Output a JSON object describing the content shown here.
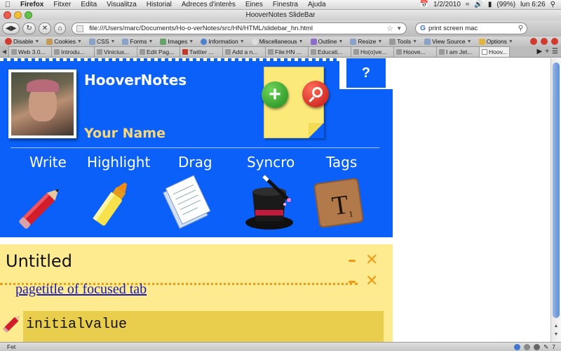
{
  "menubar": {
    "app": "Firefox",
    "items": [
      "Fitxer",
      "Edita",
      "Visualitza",
      "Historial",
      "Adreces d'interès",
      "Eines",
      "Finestra",
      "Ajuda"
    ],
    "date": "1/2/2010",
    "battery": "(99%)",
    "clock": "lun 6:26"
  },
  "window": {
    "title": "HooverNotes SlideBar"
  },
  "navbar": {
    "url": "file:///Users/marc/Documents/Ho-o-verNotes/src/HN/HTML/slidebar_hn.html",
    "search_value": "print screen mac"
  },
  "devbar": {
    "items": [
      "Disable",
      "Cookies",
      "CSS",
      "Forms",
      "Images",
      "Information",
      "Miscellaneous",
      "Outline",
      "Resize",
      "Tools",
      "View Source",
      "Options"
    ]
  },
  "tabs": [
    {
      "label": "Web 3.0..."
    },
    {
      "label": "Introdu..."
    },
    {
      "label": "Vinicius..."
    },
    {
      "label": "Edit Pag..."
    },
    {
      "label": "Twitter ..."
    },
    {
      "label": "Add a n..."
    },
    {
      "label": "File:HN ..."
    },
    {
      "label": "Educati..."
    },
    {
      "label": "Ho(o)ve..."
    },
    {
      "label": "Hoove..."
    },
    {
      "label": "I am Jet..."
    },
    {
      "label": "Hoov..."
    }
  ],
  "slidebar": {
    "title": "HooverNotes",
    "user_name": "Your Name",
    "help_label": "?",
    "add_label": "+",
    "tools": [
      {
        "label": "Write"
      },
      {
        "label": "Highlight"
      },
      {
        "label": "Drag"
      },
      {
        "label": "Syncro"
      },
      {
        "label": "Tags"
      }
    ],
    "tag_tile_letter": "T",
    "tag_tile_sub": "1"
  },
  "note": {
    "title": "Untitled",
    "minimize": "–",
    "close": "✕",
    "link_text": "pagetitle of focused tab",
    "input_value": "initialvalue"
  },
  "status": {
    "text": "Fet",
    "right_count": "7"
  },
  "colors": {
    "header_blue": "#0a60f8",
    "note_yellow": "#feeb8f",
    "accent_orange": "#f19a18",
    "name_gold": "#f6d879"
  }
}
